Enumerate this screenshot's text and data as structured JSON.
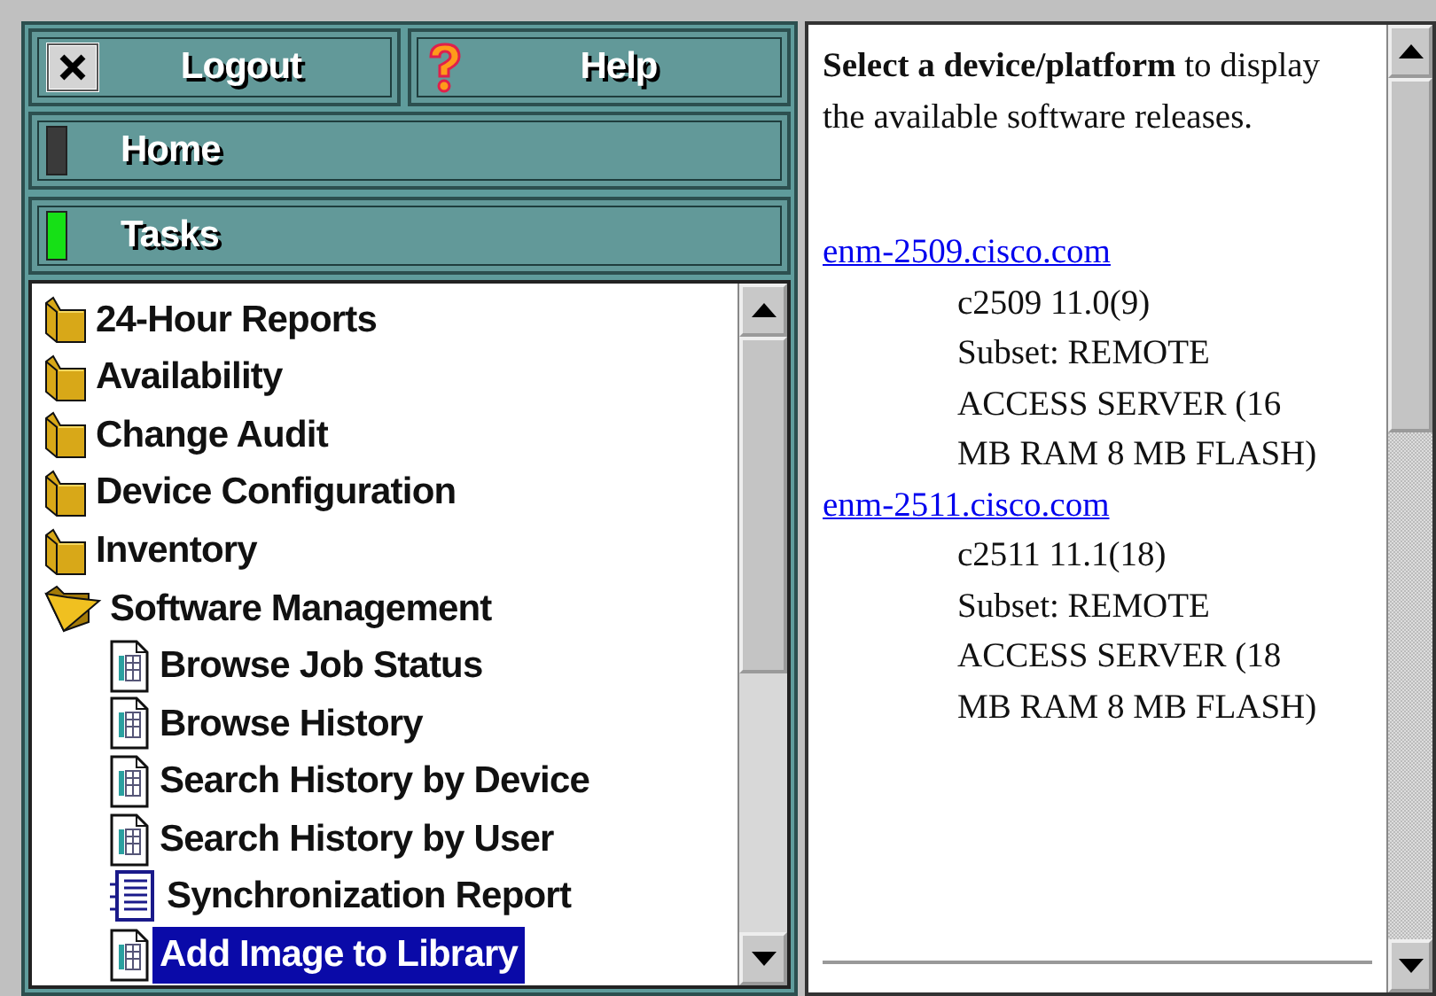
{
  "toolbar": {
    "logout": {
      "label": "Logout"
    },
    "help": {
      "label": "Help"
    }
  },
  "sections": [
    {
      "label": "Home",
      "selected": false
    },
    {
      "label": "Tasks",
      "selected": true
    }
  ],
  "tree": [
    {
      "label": "24-Hour Reports",
      "kind": "folder",
      "expanded": false,
      "selected": false
    },
    {
      "label": "Availability",
      "kind": "folder",
      "expanded": false,
      "selected": false
    },
    {
      "label": "Change Audit",
      "kind": "folder",
      "expanded": false,
      "selected": false
    },
    {
      "label": "Device Configuration",
      "kind": "folder",
      "expanded": false,
      "selected": false
    },
    {
      "label": "Inventory",
      "kind": "folder",
      "expanded": false,
      "selected": false
    },
    {
      "label": "Software Management",
      "kind": "folder",
      "expanded": true,
      "selected": false,
      "children": [
        {
          "label": "Browse Job Status",
          "kind": "page",
          "selected": false
        },
        {
          "label": "Browse History",
          "kind": "page",
          "selected": false
        },
        {
          "label": "Search History by Device",
          "kind": "page",
          "selected": false
        },
        {
          "label": "Search History by User",
          "kind": "page",
          "selected": false
        },
        {
          "label": "Synchronization Report",
          "kind": "list",
          "selected": false
        },
        {
          "label": "Add Image to Library",
          "kind": "page",
          "selected": true
        }
      ]
    }
  ],
  "content": {
    "intro": "**Select a device/platform** to display the available software releases.",
    "devices": [
      {
        "link": "enm-2509.cisco.com",
        "image": "c2509 11.0(9)",
        "details": "Subset: REMOTE ACCESS SERVER (16 MB RAM 8 MB FLASH)"
      },
      {
        "link": "enm-2511.cisco.com",
        "image": "c2511 11.1(18)",
        "details": "Subset: REMOTE ACCESS SERVER (18 MB RAM 8 MB FLASH)"
      }
    ]
  }
}
